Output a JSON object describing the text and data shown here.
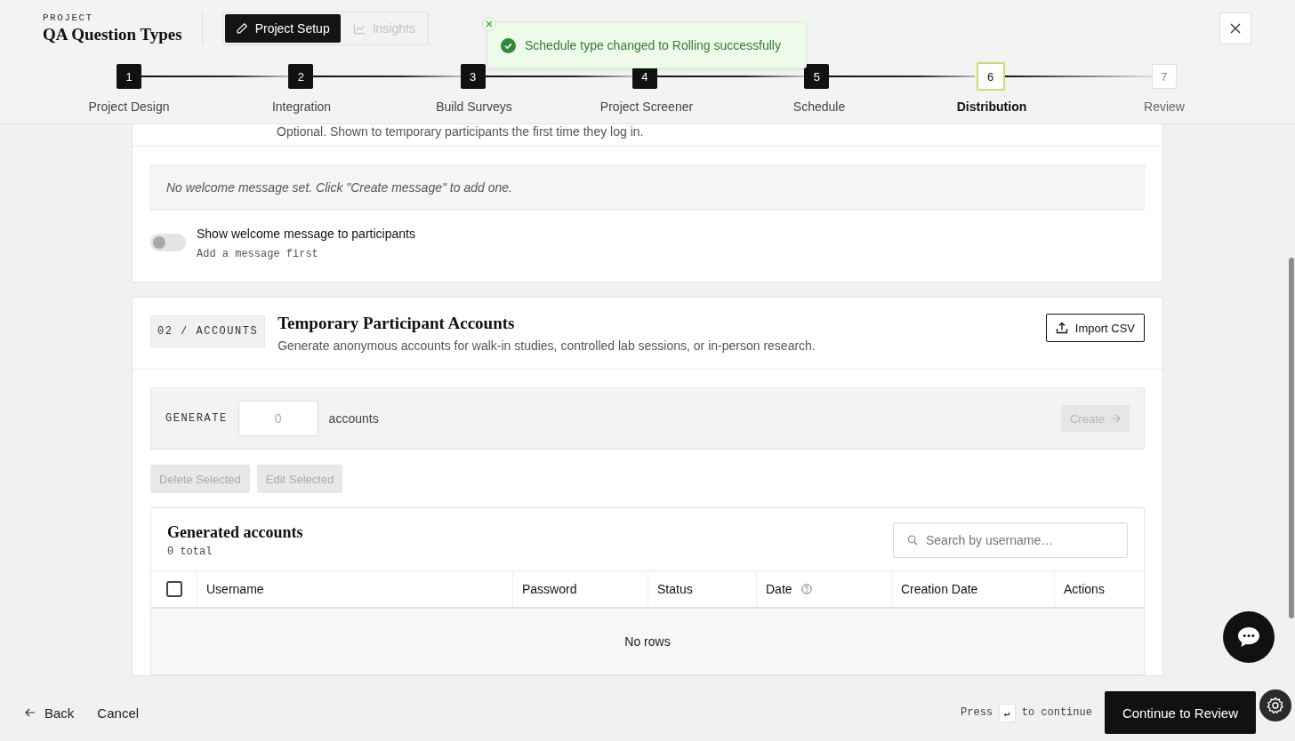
{
  "project": {
    "eyebrow": "PROJECT",
    "title": "QA Question Types"
  },
  "mode_tabs": [
    {
      "label": "Project Setup",
      "kind": "pencil",
      "selected": true
    },
    {
      "label": "Insights",
      "kind": "chart",
      "selected": false
    }
  ],
  "toast": {
    "message": "Schedule type changed to Rolling successfully"
  },
  "steps": [
    {
      "number": "1",
      "label": "Project Design",
      "completed": true,
      "selected": false
    },
    {
      "number": "2",
      "label": "Integration",
      "completed": true,
      "selected": false
    },
    {
      "number": "3",
      "label": "Build Surveys",
      "completed": true,
      "selected": false
    },
    {
      "number": "4",
      "label": "Project Screener",
      "completed": true,
      "selected": false
    },
    {
      "number": "5",
      "label": "Schedule",
      "completed": true,
      "selected": false
    },
    {
      "number": "6",
      "label": "Distribution",
      "completed": false,
      "selected": true
    },
    {
      "number": "7",
      "label": "Review",
      "completed": false,
      "selected": false
    }
  ],
  "welcome": {
    "subtitle": "Optional. Shown to temporary participants the first time they log in.",
    "empty_message": "No welcome message set. Click \"Create message\" to add one.",
    "toggle": {
      "label": "Show welcome message to participants",
      "hint": "Add a message first",
      "on": false
    }
  },
  "accounts": {
    "badge": "02 / ACCOUNTS",
    "title": "Temporary Participant Accounts",
    "description": "Generate anonymous accounts for walk-in studies, controlled lab sessions, or in-person research.",
    "import_button": "Import CSV",
    "generate": {
      "label": "GENERATE",
      "placeholder": "0",
      "unit": "accounts",
      "create_button": "Create",
      "create_disabled": true
    },
    "actions": [
      {
        "label": "Delete Selected",
        "disabled": true
      },
      {
        "label": "Edit Selected",
        "disabled": true
      }
    ],
    "table": {
      "title": "Generated accounts",
      "count": "0 total",
      "search_placeholder": "Search by username…",
      "select_all_checked": false,
      "columns": [
        {
          "label": "Username",
          "help": false
        },
        {
          "label": "Password",
          "help": false
        },
        {
          "label": "Status",
          "help": false
        },
        {
          "label": "Date",
          "help": true
        },
        {
          "label": "Creation Date",
          "help": false
        },
        {
          "label": "Actions",
          "help": false
        }
      ],
      "empty": "No rows"
    }
  },
  "footer": {
    "back": "Back",
    "cancel": "Cancel",
    "hint_prefix": "Press",
    "key": "↵",
    "hint_suffix": "to continue",
    "primary": "Continue to Review"
  }
}
